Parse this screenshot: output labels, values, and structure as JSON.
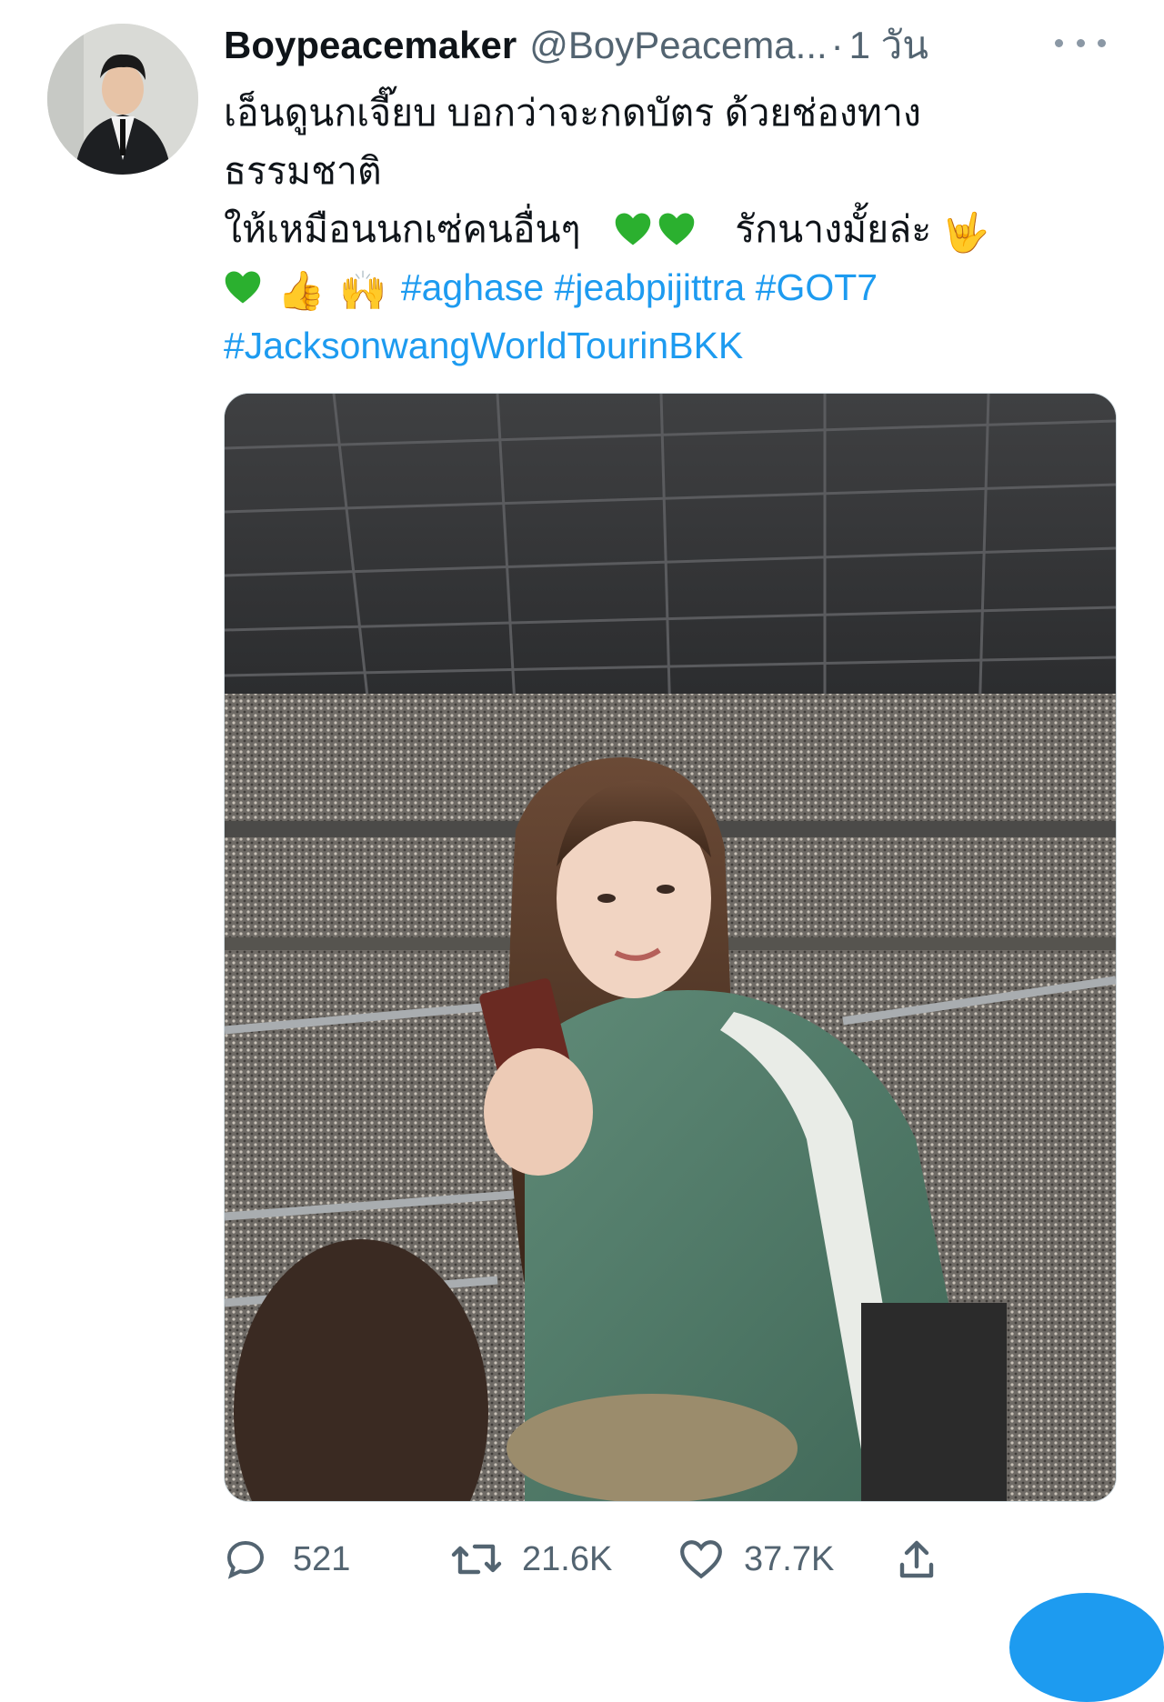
{
  "tweet": {
    "display_name": "Boypeacemaker",
    "handle": "@BoyPeacema...",
    "separator": "·",
    "time": "1 วัน",
    "text_line1": "เอ็นดูนกเจี๊ยบ บอกว่าจะกดบัตร ด้วยช่องทาง",
    "text_line2": "ธรรมชาติ",
    "text_line3": "ให้เหมือนนกเซ่คนอื่นๆ",
    "text_line3b": "รักนางมั้ยล่ะ",
    "emoji_line3_end": "🤟",
    "emoji_thumbs": "👍",
    "emoji_raise": "🙌",
    "hashtags_line4": [
      "#aghase",
      "#jeabpijittra",
      "#GOT7"
    ],
    "hashtag_line5": "#JacksonwangWorldTourinBKK",
    "heart_color": "#2bb02f"
  },
  "actions": {
    "reply_count": "521",
    "retweet_count": "21.6K",
    "like_count": "37.7K"
  },
  "colors": {
    "link": "#1d9bf0",
    "muted": "#536471"
  }
}
